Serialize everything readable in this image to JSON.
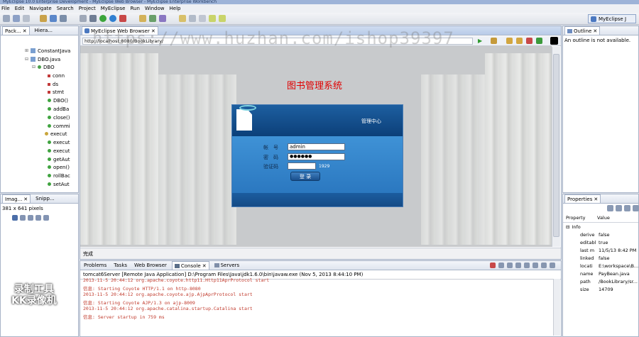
{
  "window": {
    "title": "MyEclipse 10.0 Enterprise Development - MyEclipse Web Browser - MyEclipse Enterprise Workbench"
  },
  "menu": [
    "File",
    "Edit",
    "Navigate",
    "Search",
    "Project",
    "MyEclipse",
    "Run",
    "Window",
    "Help"
  ],
  "perspective": {
    "label": "MyEclipse J"
  },
  "left_panel": {
    "tabs": [
      {
        "label": "Pack..."
      },
      {
        "label": "Hiera..."
      }
    ],
    "tree": [
      {
        "label": "ConstantJava"
      },
      {
        "label": "DBO.java"
      },
      {
        "label": "DBO"
      },
      {
        "label": "conn"
      },
      {
        "label": "ds"
      },
      {
        "label": "stmt"
      },
      {
        "label": "DBO()"
      },
      {
        "label": "addBa"
      },
      {
        "label": "close()"
      },
      {
        "label": "commi"
      },
      {
        "label": "execut"
      },
      {
        "label": "execut"
      },
      {
        "label": "execut"
      },
      {
        "label": "getAut"
      },
      {
        "label": "open()"
      },
      {
        "label": "rollBac"
      },
      {
        "label": "setAut"
      }
    ]
  },
  "image_panel": {
    "tabs": [
      {
        "label": "Imag..."
      },
      {
        "label": "Snipp..."
      }
    ],
    "size_text": "381 x 641 pixels"
  },
  "browser": {
    "tab_label": "MyEclipse Web Browser",
    "url": "http://localhost:8080/BookLibrary/",
    "status": "完成",
    "page": {
      "heading": "图书管理系统",
      "panel_title": "管理中心",
      "username_label": "帐　号",
      "username_value": "admin",
      "password_label": "密　码",
      "password_value": "●●●●●●",
      "captcha_label": "验证码",
      "captcha_value": "",
      "captcha_code": "1929",
      "login_button": "登 录"
    }
  },
  "outline": {
    "tab_label": "Outline",
    "message": "An outline is not available."
  },
  "properties": {
    "tab_label": "Properties",
    "header": {
      "property": "Property",
      "value": "Value"
    },
    "group": "Info",
    "rows": [
      {
        "k": "derive",
        "v": "false"
      },
      {
        "k": "editabl",
        "v": "true"
      },
      {
        "k": "last m",
        "v": "11/5/13 8:42 PM"
      },
      {
        "k": "linked",
        "v": "false"
      },
      {
        "k": "locati",
        "v": "E:\\workspace\\B..."
      },
      {
        "k": "name",
        "v": "PayBean.java"
      },
      {
        "k": "path",
        "v": "/BookLibrary/sr..."
      },
      {
        "k": "size",
        "v": "14709"
      }
    ]
  },
  "console": {
    "tabs": [
      {
        "label": "Problems"
      },
      {
        "label": "Tasks"
      },
      {
        "label": "Web Browser"
      },
      {
        "label": "Console"
      },
      {
        "label": "Servers"
      }
    ],
    "header": "tomcat6Server [Remote Java Application] D:\\Program Files\\Java\\jdk1.6.0\\bin\\javaw.exe (Nov 5, 2013 8:44:10 PM)",
    "lines": [
      "2013-11-5 20:44:12 org.apache.coyote.http11.Http11AprProtocol start",
      "信息: Starting Coyote HTTP/1.1 on http-8080",
      "2013-11-5 20:44:12 org.apache.coyote.ajp.AjpAprProtocol start",
      "信息: Starting Coyote AJP/1.3 on ajp-8009",
      "2013-11-5 20:44:12 org.apache.catalina.startup.Catalina start",
      "信息: Server startup in 759 ms"
    ]
  },
  "watermark": {
    "url": "https://www.huzhan.com/ishop39397",
    "badge_line1": "录制工具",
    "badge_line2": "KK录像机"
  },
  "colors": {
    "accent": "#2b78c0",
    "heading_red": "#e00000",
    "console_red": "#c0392b"
  }
}
